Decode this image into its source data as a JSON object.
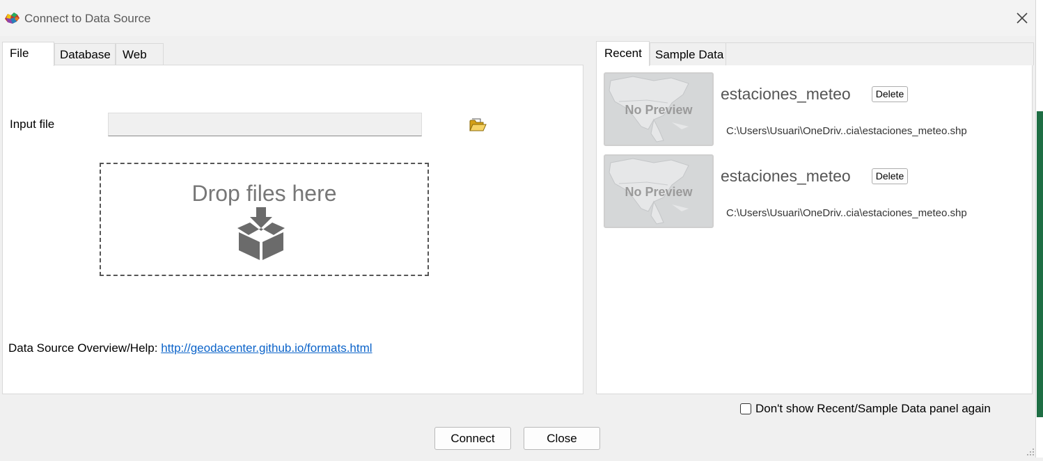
{
  "window": {
    "title": "Connect to Data Source",
    "icons": {
      "app": "geoda-app-icon",
      "close": "close-icon"
    }
  },
  "left_tabs": [
    {
      "label": "File",
      "active": true
    },
    {
      "label": "Database",
      "active": false
    },
    {
      "label": "Web",
      "active": false
    }
  ],
  "file_tab": {
    "input_label": "Input file",
    "input_value": "",
    "browse_icon": "open-folder-icon",
    "drop_text": "Drop files here",
    "drop_icon": "drop-box-icon",
    "help_label": "Data Source Overview/Help: ",
    "help_link": "http://geodacenter.github.io/formats.html"
  },
  "right_tabs": [
    {
      "label": "Recent",
      "active": true
    },
    {
      "label": "Sample Data",
      "active": false
    }
  ],
  "recent": [
    {
      "thumbnail_text": "No Preview",
      "name": "estaciones_meteo",
      "delete_label": "Delete",
      "path": "C:\\Users\\Usuari\\OneDriv..cia\\estaciones_meteo.shp"
    },
    {
      "thumbnail_text": "No Preview",
      "name": "estaciones_meteo",
      "delete_label": "Delete",
      "path": "C:\\Users\\Usuari\\OneDriv..cia\\estaciones_meteo.shp"
    }
  ],
  "footer": {
    "dont_show_label": "Don't show Recent/Sample Data panel again",
    "dont_show_checked": false,
    "connect_label": "Connect",
    "close_label": "Close"
  },
  "colors": {
    "link": "#0b63c9",
    "panel_bg": "#ffffff",
    "window_bg": "#f0f0f0"
  }
}
